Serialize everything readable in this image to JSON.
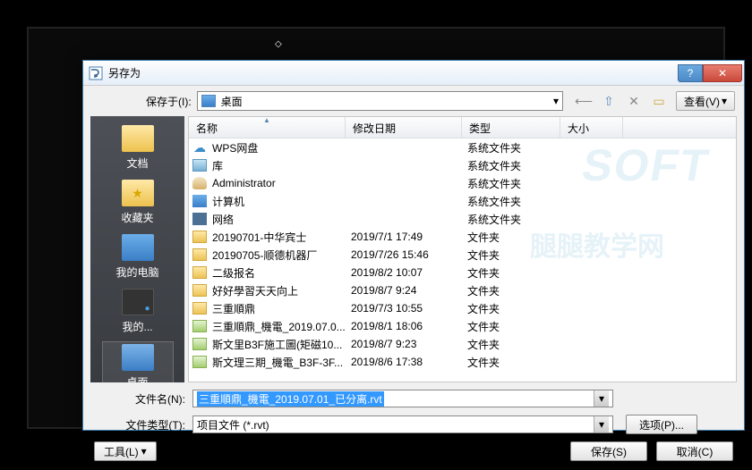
{
  "dialog": {
    "title": "另存为",
    "save_in_label": "保存于(I):",
    "save_in_value": "桌面",
    "view_label": "查看(V)"
  },
  "sidebar": {
    "items": [
      {
        "label": "文档",
        "icon": "folder"
      },
      {
        "label": "收藏夹",
        "icon": "fav"
      },
      {
        "label": "我的电脑",
        "icon": "comp"
      },
      {
        "label": "我的...",
        "icon": "net"
      },
      {
        "label": "桌面",
        "icon": "desk"
      }
    ]
  },
  "columns": {
    "name": "名称",
    "date": "修改日期",
    "type": "类型",
    "size": "大小"
  },
  "files": [
    {
      "icon": "cloud",
      "name": "WPS网盘",
      "date": "",
      "type": "系统文件夹",
      "size": ""
    },
    {
      "icon": "lib",
      "name": "库",
      "date": "",
      "type": "系统文件夹",
      "size": ""
    },
    {
      "icon": "user",
      "name": "Administrator",
      "date": "",
      "type": "系统文件夹",
      "size": ""
    },
    {
      "icon": "comp",
      "name": "计算机",
      "date": "",
      "type": "系统文件夹",
      "size": ""
    },
    {
      "icon": "net",
      "name": "网络",
      "date": "",
      "type": "系统文件夹",
      "size": ""
    },
    {
      "icon": "folder",
      "name": "20190701-中华宾士",
      "date": "2019/7/1 17:49",
      "type": "文件夹",
      "size": ""
    },
    {
      "icon": "folder",
      "name": "20190705-顺德机器厂",
      "date": "2019/7/26 15:46",
      "type": "文件夹",
      "size": ""
    },
    {
      "icon": "folder",
      "name": "二级报名",
      "date": "2019/8/2 10:07",
      "type": "文件夹",
      "size": ""
    },
    {
      "icon": "folder",
      "name": "好好學習天天向上",
      "date": "2019/8/7 9:24",
      "type": "文件夹",
      "size": ""
    },
    {
      "icon": "folder",
      "name": "三重順鼎",
      "date": "2019/7/3 10:55",
      "type": "文件夹",
      "size": ""
    },
    {
      "icon": "pfolder",
      "name": "三重順鼎_機電_2019.07.0...",
      "date": "2019/8/1 18:06",
      "type": "文件夹",
      "size": ""
    },
    {
      "icon": "pfolder",
      "name": "斯文里B3F施工圖(矩磁10...",
      "date": "2019/8/7 9:23",
      "type": "文件夹",
      "size": ""
    },
    {
      "icon": "pfolder",
      "name": "斯文理三期_機電_B3F-3F...",
      "date": "2019/8/6 17:38",
      "type": "文件夹",
      "size": ""
    }
  ],
  "fields": {
    "filename_label": "文件名(N):",
    "filename_value": "三重順鼎_機電_2019.07.01_已分离.rvt",
    "filetype_label": "文件类型(T):",
    "filetype_value": "项目文件 (*.rvt)"
  },
  "buttons": {
    "options": "选项(P)...",
    "tools": "工具(L)",
    "save": "保存(S)",
    "cancel": "取消(C)"
  },
  "watermark": {
    "line1": "SOFT",
    "line2": "腿腿教学网"
  }
}
